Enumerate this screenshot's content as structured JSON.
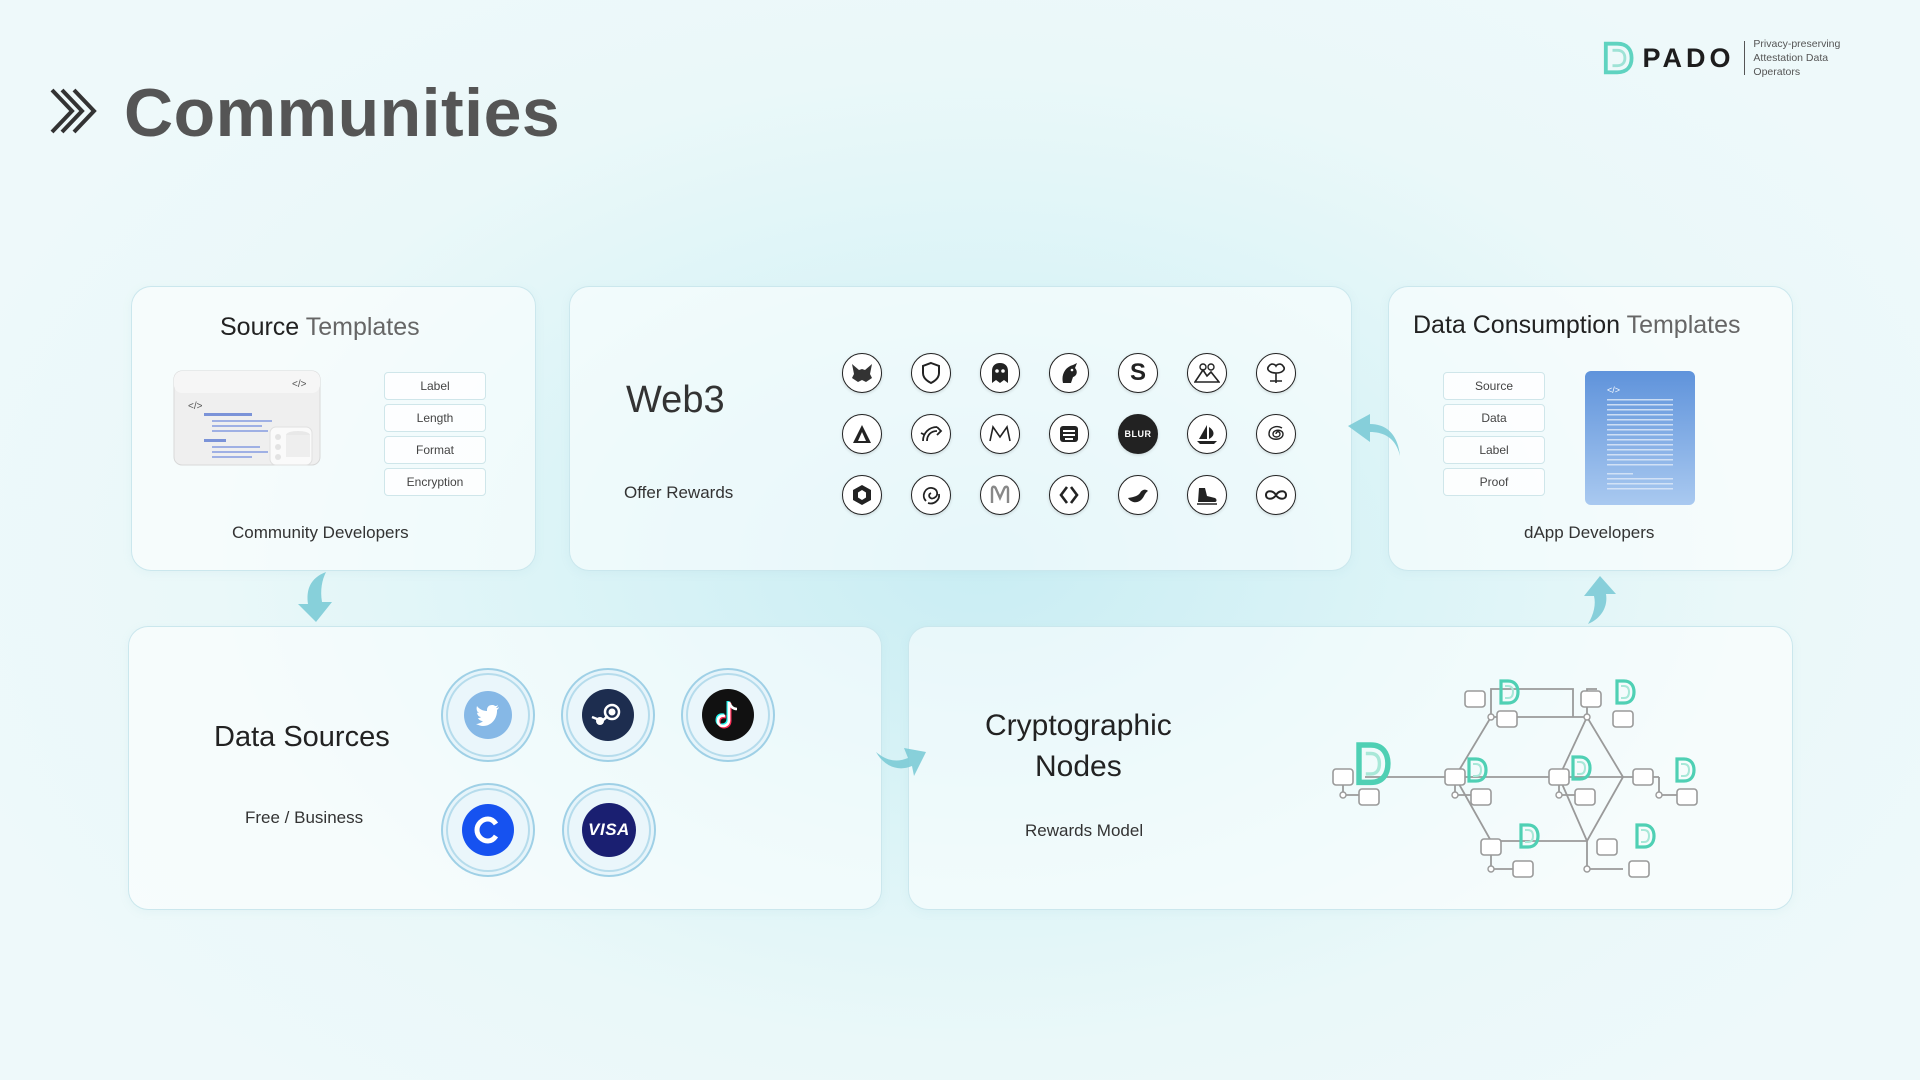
{
  "page": {
    "title": "Communities"
  },
  "brand": {
    "name": "PADO",
    "tagline_line1": "Privacy-preserving",
    "tagline_line2": "Attestation Data Operators",
    "accent_color": "#5fd3c0"
  },
  "source_templates": {
    "title_bold": "Source",
    "title_light": "Templates",
    "code_tag": "</>",
    "fields": [
      "Label",
      "Length",
      "Format",
      "Encryption"
    ],
    "caption": "Community Developers"
  },
  "web3": {
    "title": "Web3",
    "subtitle": "Offer Rewards",
    "icons": [
      "metamask-icon",
      "shield-icon",
      "ghost-icon",
      "unicorn-icon",
      "s-icon",
      "mountain-icon",
      "tree-icon",
      "triangle-icon",
      "dragon-icon",
      "m-icon",
      "box-icon",
      "blur-icon",
      "sail-icon",
      "spiral-icon",
      "cube-icon",
      "swirl-icon",
      "mm-icon",
      "brackets-icon",
      "wave-icon",
      "boot-icon",
      "infinity-icon"
    ],
    "blur_label": "BLUR"
  },
  "data_consumption": {
    "title_bold": "Data Consumption",
    "title_light": "Templates",
    "code_tag": "</>",
    "fields": [
      "Source",
      "Data",
      "Label",
      "Proof"
    ],
    "caption": "dApp Developers"
  },
  "data_sources": {
    "title": "Data Sources",
    "subtitle": "Free / Business",
    "icons": [
      "twitter-icon",
      "steam-icon",
      "tiktok-icon",
      "coinbase-icon",
      "visa-icon"
    ],
    "visa_label": "VISA"
  },
  "crypto_nodes": {
    "title_line1": "Cryptographic",
    "title_line2": "Nodes",
    "subtitle": "Rewards Model"
  },
  "colors": {
    "arrow": "#7ccbd6",
    "card_border": "#c8e6ec",
    "title_gray": "#555555"
  }
}
